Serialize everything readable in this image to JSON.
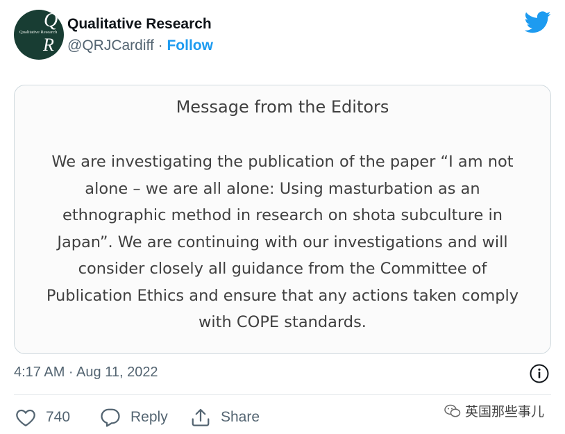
{
  "account": {
    "avatar_letters": {
      "top": "Q",
      "bottom": "R",
      "small_text": "Qualitative Research"
    },
    "display_name": "Qualitative Research",
    "handle": "@QRJCardiff",
    "separator": " · ",
    "follow_label": "Follow"
  },
  "brand": {
    "icon": "twitter-bird-icon",
    "color": "#1d9bf0"
  },
  "card": {
    "title": "Message from the Editors",
    "lines": [
      "We are investigating the publication of the paper “I am not",
      "alone – we are all alone: Using masturbation as an",
      "ethnographic method in research on shota subculture in",
      "Japan”. We are continuing with our investigations and will",
      "consider closely all guidance from the Committee of",
      "Publication Ethics and ensure that any actions taken comply",
      "with COPE standards."
    ]
  },
  "meta": {
    "timestamp": "4:17 AM · Aug 11, 2022",
    "info_icon": "info-icon"
  },
  "actions": {
    "like": {
      "icon": "heart-icon",
      "count": "740"
    },
    "reply": {
      "icon": "reply-icon",
      "label": "Reply"
    },
    "share": {
      "icon": "share-icon",
      "label": "Share"
    }
  },
  "watermark": {
    "icon": "wechat-icon",
    "text": "英国那些事儿"
  }
}
